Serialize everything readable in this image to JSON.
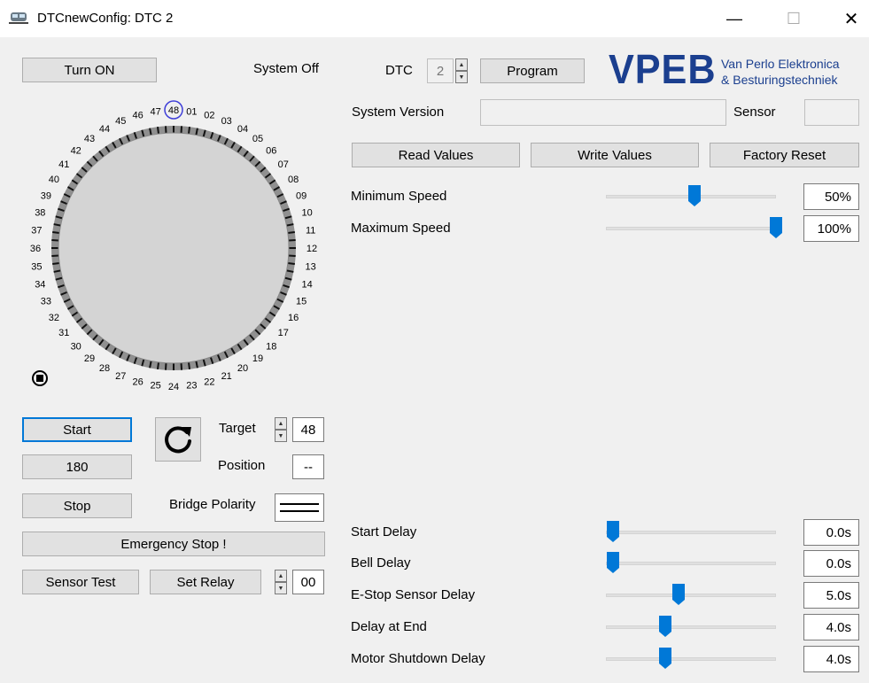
{
  "window": {
    "title": "DTCnewConfig: DTC 2",
    "minimize_glyph": "—",
    "maximize_glyph": "☐",
    "close_glyph": "✕"
  },
  "left": {
    "turn_on_label": "Turn ON",
    "system_status": "System Off",
    "dial_numbers": [
      "01",
      "02",
      "03",
      "04",
      "05",
      "06",
      "07",
      "08",
      "09",
      "10",
      "11",
      "12",
      "13",
      "14",
      "15",
      "16",
      "17",
      "18",
      "19",
      "20",
      "21",
      "22",
      "23",
      "24",
      "25",
      "26",
      "27",
      "28",
      "29",
      "30",
      "31",
      "32",
      "33",
      "34",
      "35",
      "36",
      "37",
      "38",
      "39",
      "40",
      "41",
      "42",
      "43",
      "44",
      "45",
      "46",
      "47",
      "48"
    ],
    "dial_selected": "48",
    "start_label": "Start",
    "speed_value": "180",
    "stop_label": "Stop",
    "emergency_label": "Emergency Stop !",
    "sensor_test_label": "Sensor Test",
    "set_relay_label": "Set Relay",
    "relay_value": "00",
    "target_label": "Target",
    "target_value": "48",
    "position_label": "Position",
    "position_value": "--",
    "bridge_polarity_label": "Bridge Polarity"
  },
  "top": {
    "dtc_label": "DTC",
    "dtc_value": "2",
    "program_label": "Program",
    "logo_text": "VPEB",
    "company_line1": "Van Perlo Elektronica",
    "company_line2": "& Besturingstechniek",
    "system_version_label": "System Version",
    "system_version_value": "",
    "sensor_label": "Sensor",
    "sensor_value": "",
    "read_values_label": "Read Values",
    "write_values_label": "Write Values",
    "factory_reset_label": "Factory Reset"
  },
  "sliders": [
    {
      "label": "Minimum Speed",
      "display": "50%",
      "fraction": 0.5
    },
    {
      "label": "Maximum Speed",
      "display": "100%",
      "fraction": 1.0
    },
    {
      "label": "Start Delay",
      "display": "0.0s",
      "fraction": 0.0
    },
    {
      "label": "Bell Delay",
      "display": "0.0s",
      "fraction": 0.0
    },
    {
      "label": "E-Stop Sensor Delay",
      "display": "5.0s",
      "fraction": 0.4
    },
    {
      "label": "Delay at End",
      "display": "4.0s",
      "fraction": 0.32
    },
    {
      "label": "Motor Shutdown Delay",
      "display": "4.0s",
      "fraction": 0.32
    }
  ],
  "colors": {
    "accent": "#0078d7",
    "logo_blue": "#1b3f8f",
    "dial_ring": "#909090",
    "dial_face": "#d4d4d4",
    "selected_ring": "#3f3fd8"
  }
}
